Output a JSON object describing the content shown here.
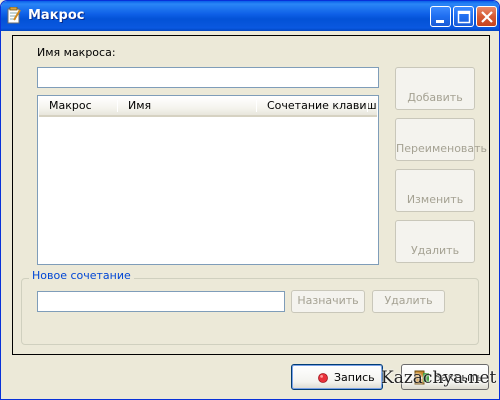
{
  "window": {
    "title": "Макрос",
    "icon": "notepad-icon",
    "controls": [
      "minimize-icon",
      "maximize-icon",
      "close-icon"
    ]
  },
  "form": {
    "macro_name_label": "Имя макроса:",
    "macro_name_value": "",
    "table": {
      "columns": [
        "Макрос",
        "Имя",
        "Сочетание клавиш"
      ],
      "rows": []
    },
    "side_buttons": {
      "add": "Добавить",
      "rename": "Переименовать",
      "edit": "Изменить",
      "delete": "Удалить"
    },
    "shortcut_group": {
      "title": "Новое сочетание",
      "value": "",
      "assign": "Назначить",
      "delete": "Удалить"
    }
  },
  "footer": {
    "record": "Запись",
    "close": "Закрыть",
    "record_icon_color": "#e8303a"
  },
  "watermark": {
    "text": "Kazachya.net"
  },
  "colors": {
    "titlebar": "#0a5fe8",
    "face": "#ece9d8",
    "group_title": "#0046d5",
    "disabled_text": "#a5a293"
  }
}
